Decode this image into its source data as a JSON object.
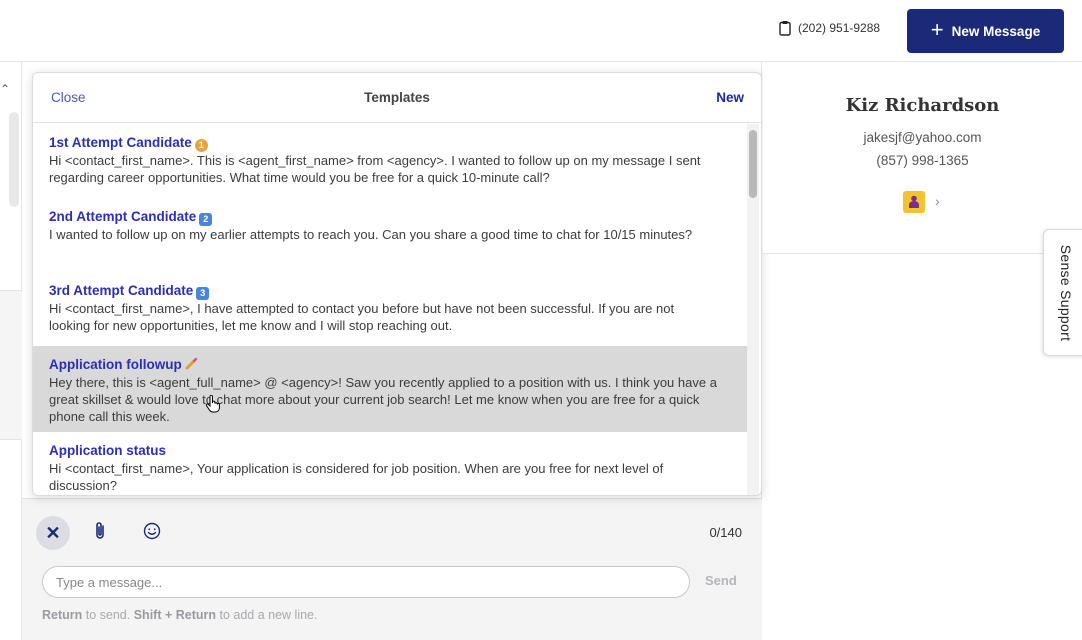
{
  "header": {
    "phone": "(202) 951-9288",
    "new_message_label": "New Message"
  },
  "templates": {
    "close_label": "Close",
    "title": "Templates",
    "new_label": "New",
    "items": [
      {
        "name": "1st Attempt Candidate",
        "emoji": "medal",
        "body": "Hi <contact_first_name>. This is <agent_first_name> from <agency>. I wanted to follow up on my message I sent regarding career opportunities. What time would you be free for a quick 10-minute call?"
      },
      {
        "name": "2nd Attempt Candidate",
        "emoji": "keycap-2",
        "body": "I wanted to follow up on my earlier attempts to reach you. Can you share a good time to chat for 10/15 minutes?"
      },
      {
        "name": "3rd Attempt Candidate",
        "emoji": "keycap-3",
        "body": "Hi <contact_first_name>, I have attempted to contact you before but have not been successful. If you are not looking for new opportunities, let me know and I will stop reaching out."
      },
      {
        "name": "Application followup",
        "emoji": "nail-polish",
        "body": "Hey there, this is <agent_full_name> @ <agency>! Saw you recently applied to a position with us. I think you have a great skillset & would love to chat more about your current job search! Let me know when you are free for a quick phone call this week."
      },
      {
        "name": "Application status",
        "emoji": "",
        "body": "Hi <contact_first_name>, Your application is considered for job position. When are you free for next level of discussion?"
      }
    ]
  },
  "composer": {
    "counter": "0/140",
    "placeholder": "Type a message...",
    "send_label": "Send",
    "hint_return": "Return",
    "hint_to_send": " to send. ",
    "hint_shift_return": "Shift + Return",
    "hint_new_line": " to add a new line."
  },
  "contact": {
    "name": "Kiz Richardson",
    "email": "jakesjf@yahoo.com",
    "phone": "(857) 998-1365"
  },
  "support_tab_label": "Sense Support",
  "colors": {
    "brand_navy": "#1b2a78",
    "link_blue": "#2a2fb5",
    "hover_row": "#d9d9d9",
    "badge_yellow": "#f2c230"
  }
}
